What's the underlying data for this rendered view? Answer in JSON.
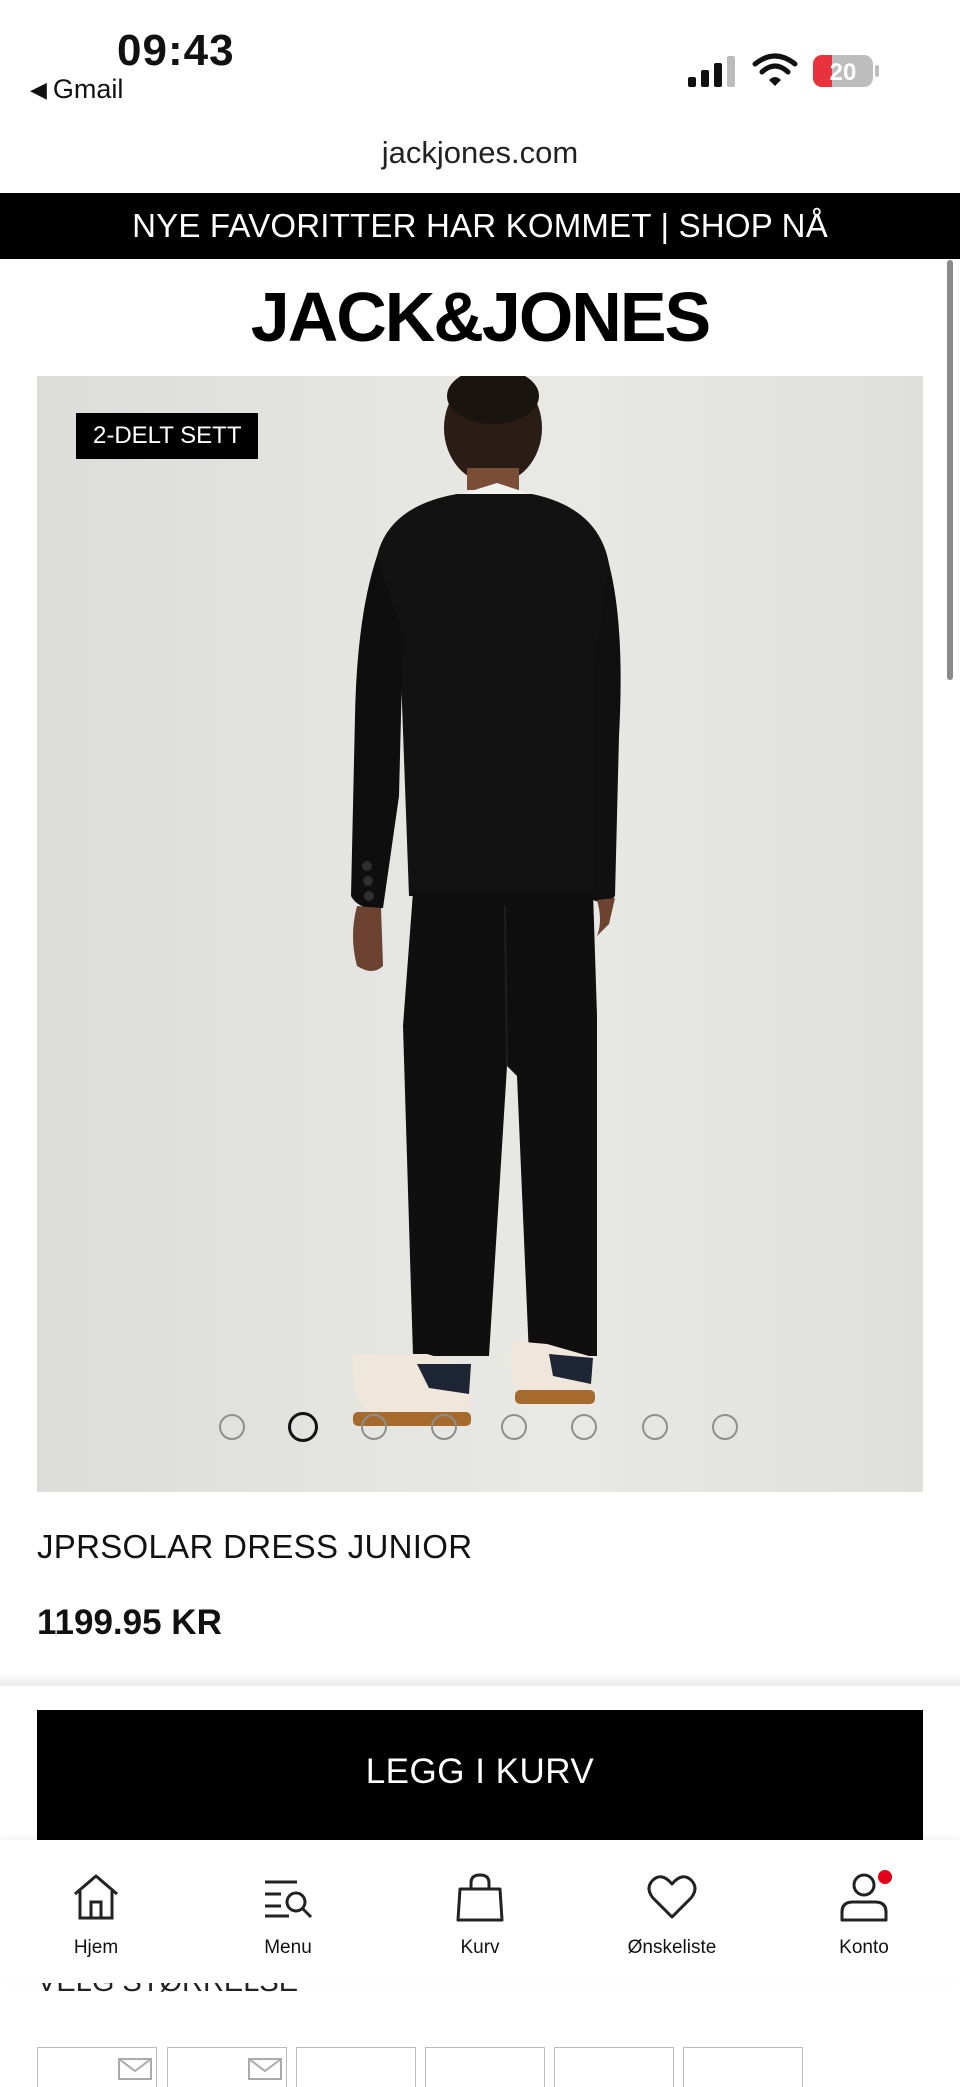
{
  "status_bar": {
    "time": "09:43",
    "back_app": "Gmail",
    "battery_level": "20",
    "icons": [
      "cellular-signal-icon",
      "wifi-icon",
      "battery-icon"
    ]
  },
  "browser": {
    "url": "jackjones.com"
  },
  "promo_banner": {
    "text": "NYE FAVORITTER HAR KOMMET | SHOP NÅ"
  },
  "brand": {
    "logo_text": "JACK&JONES"
  },
  "product": {
    "badge": "2-DELT SETT",
    "name": "JPRSOLAR DRESS JUNIOR",
    "price": "1199.95 KR",
    "image_count": 8,
    "active_image_index": 1
  },
  "actions": {
    "add_to_cart": "LEGG I KURV"
  },
  "size_section": {
    "heading": "VELG STØRRELSE",
    "visible_boxes": 6
  },
  "bottom_nav": {
    "items": [
      {
        "label": "Hjem",
        "icon": "home-icon"
      },
      {
        "label": "Menu",
        "icon": "menu-search-icon"
      },
      {
        "label": "Kurv",
        "icon": "shopping-bag-icon"
      },
      {
        "label": "Ønskeliste",
        "icon": "heart-icon"
      },
      {
        "label": "Konto",
        "icon": "account-icon",
        "notification": true
      }
    ]
  },
  "colors": {
    "accent": "#000000",
    "notification": "#e2001a",
    "battery_low": "#e8323c"
  }
}
